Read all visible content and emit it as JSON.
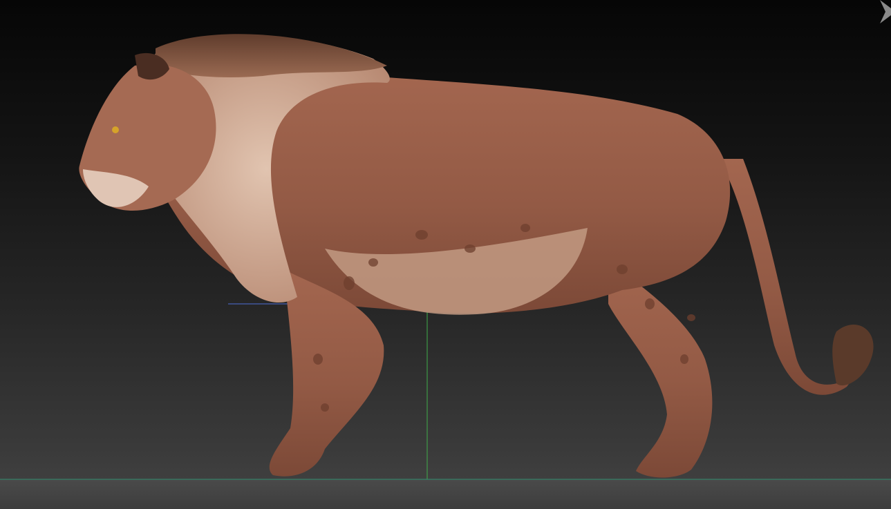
{
  "viewport": {
    "background_top": "#060606",
    "background_bottom": "#444444"
  },
  "axes": {
    "x_axis_color": "#4f6fd8",
    "y_axis_color": "#3fae4a",
    "floor_line_color": "#2f8f6f"
  },
  "model": {
    "subject": "lion-sculpt",
    "body_color": "#9a5e48",
    "fur_color": "#c8a38c",
    "mane_color": "#6b4533",
    "eye_color": "#d6a32a",
    "spot_color": "#6e3f2e"
  },
  "icons": {
    "corner": "chevron-right-icon"
  }
}
